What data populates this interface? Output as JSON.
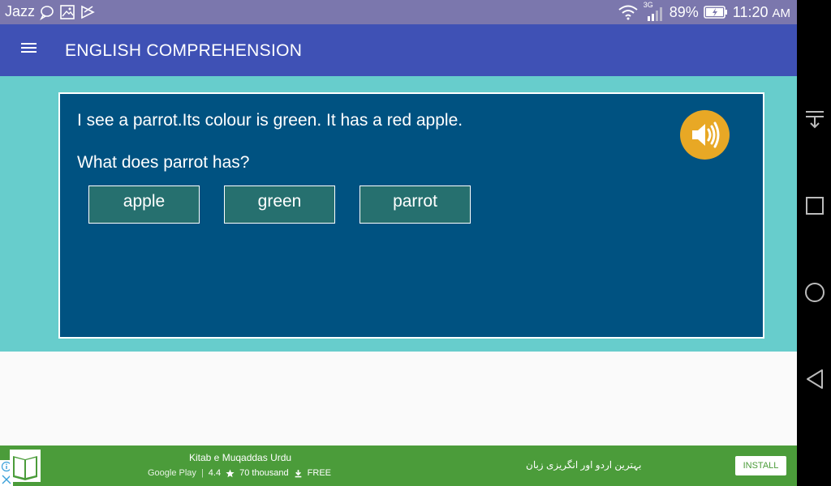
{
  "status_bar": {
    "carrier": "Jazz",
    "network_type": "3G",
    "battery": "89%",
    "time": "11:20",
    "ampm": "AM"
  },
  "app_bar": {
    "title": "ENGLISH COMPREHENSION",
    "menu_icon": "hamburger-menu-icon"
  },
  "quiz": {
    "passage": "I see a parrot.Its colour is green. It has a red apple.",
    "question": "What does parrot has?",
    "options": [
      {
        "label": "apple"
      },
      {
        "label": "green"
      },
      {
        "label": "parrot"
      }
    ],
    "speaker_icon": "speaker-icon"
  },
  "ad": {
    "title": "Kitab e Muqaddas Urdu",
    "store": "Google Play",
    "rating": "4.4",
    "downloads": "70 thousand",
    "price": "FREE",
    "tagline": "بہترین اردو اور انگریزی زبان",
    "install_label": "INSTALL"
  },
  "colors": {
    "status_bar": "#7b77ad",
    "app_bar": "#3f51b5",
    "content_bg": "#67cdcc",
    "card": "#005281",
    "option": "#26706f",
    "speaker": "#e8a825",
    "ad_banner": "#4b9c3a"
  }
}
